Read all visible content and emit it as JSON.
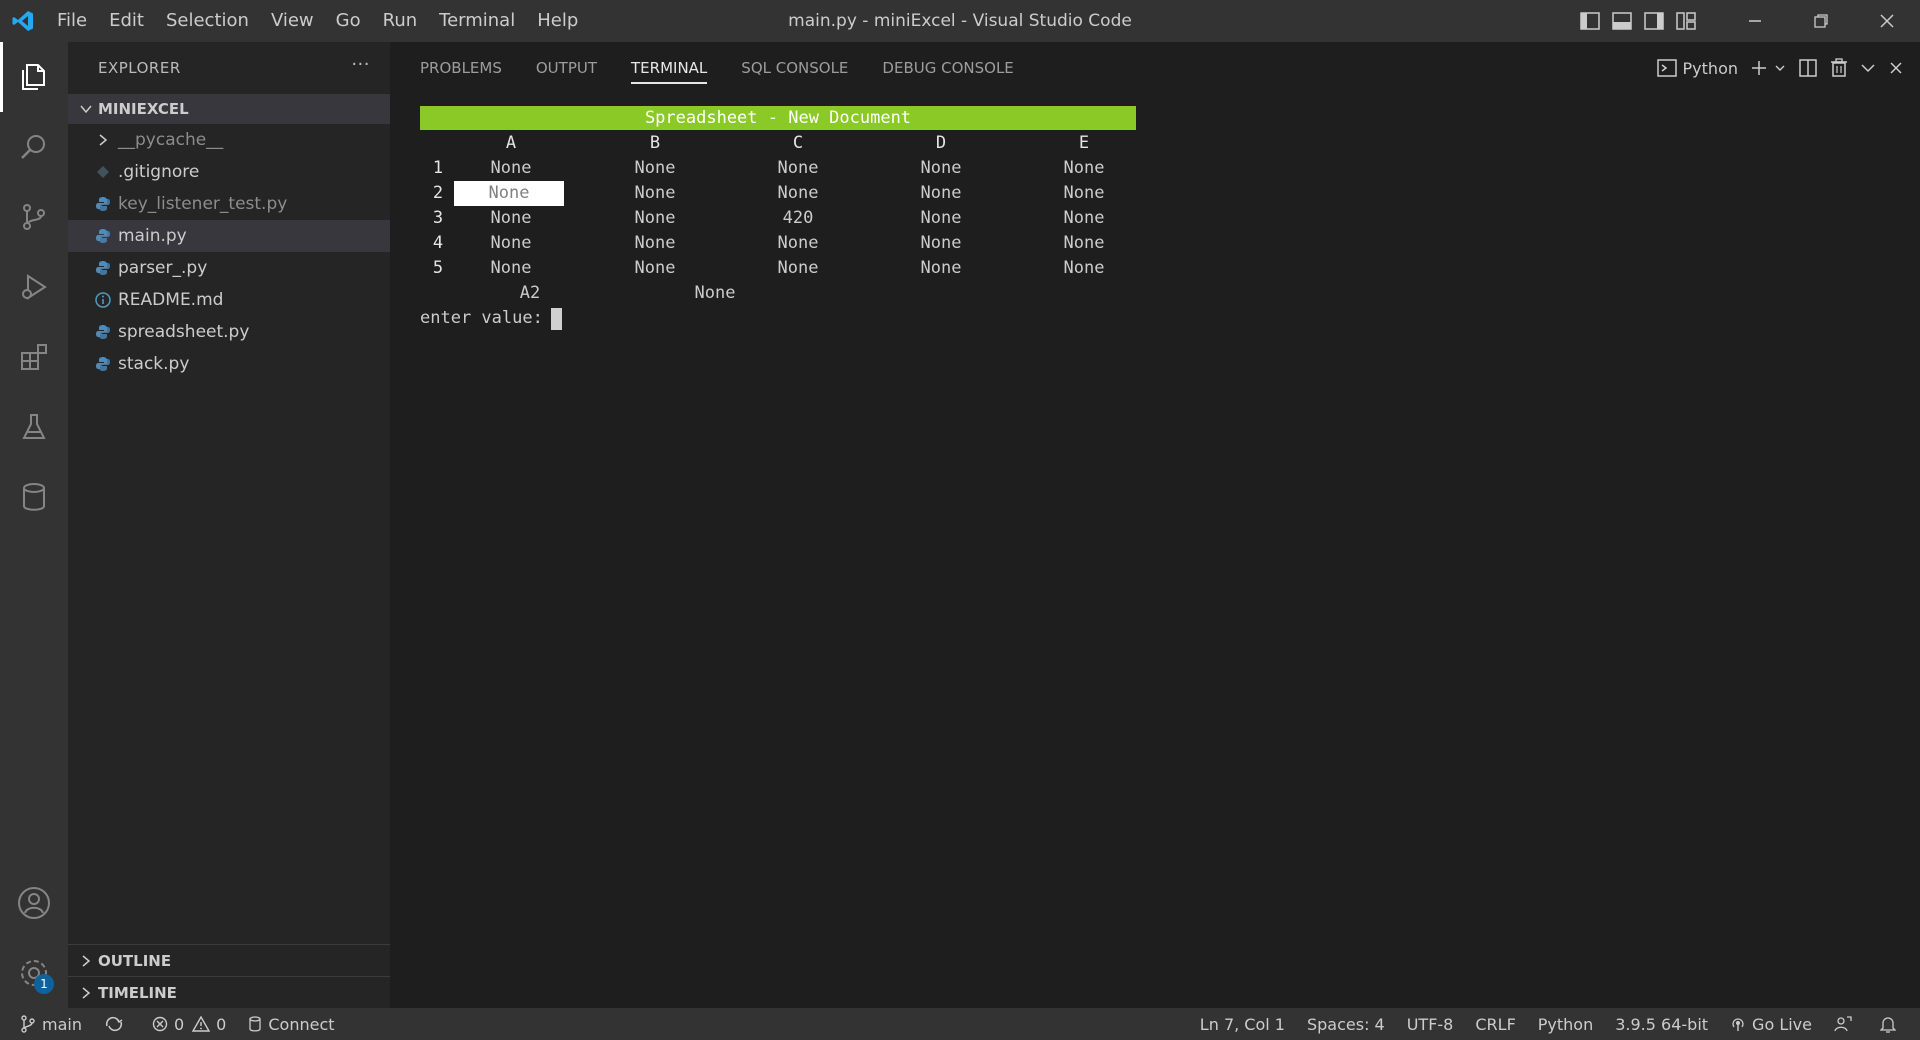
{
  "titlebar": {
    "menu": [
      "File",
      "Edit",
      "Selection",
      "View",
      "Go",
      "Run",
      "Terminal",
      "Help"
    ],
    "window_title": "main.py - miniExcel - Visual Studio Code"
  },
  "sidebar": {
    "title": "EXPLORER",
    "more": "···",
    "folder": "MINIEXCEL",
    "items": [
      {
        "label": "__pycache__",
        "icon": "chevron-right-icon"
      },
      {
        "label": ".gitignore",
        "icon": "diamond-icon"
      },
      {
        "label": "key_listener_test.py",
        "icon": "python-icon"
      },
      {
        "label": "main.py",
        "icon": "python-icon"
      },
      {
        "label": "parser_.py",
        "icon": "python-icon"
      },
      {
        "label": "README.md",
        "icon": "info-icon"
      },
      {
        "label": "spreadsheet.py",
        "icon": "python-icon"
      },
      {
        "label": "stack.py",
        "icon": "python-icon"
      }
    ],
    "outline": "OUTLINE",
    "timeline": "TIMELINE",
    "settings_badge": "1"
  },
  "panel": {
    "tabs": [
      "PROBLEMS",
      "OUTPUT",
      "TERMINAL",
      "SQL CONSOLE",
      "DEBUG CONSOLE"
    ],
    "active_tab": "TERMINAL",
    "terminal_profile": "Python"
  },
  "terminal": {
    "title": "Spreadsheet - New Document",
    "columns": [
      "A",
      "B",
      "C",
      "D",
      "E"
    ],
    "rows": [
      {
        "num": "1",
        "cells": [
          "None",
          "None",
          "None",
          "None",
          "None"
        ]
      },
      {
        "num": "2",
        "cells": [
          "None",
          "None",
          "None",
          "None",
          "None"
        ]
      },
      {
        "num": "3",
        "cells": [
          "None",
          "None",
          "420",
          "None",
          "None"
        ]
      },
      {
        "num": "4",
        "cells": [
          "None",
          "None",
          "None",
          "None",
          "None"
        ]
      },
      {
        "num": "5",
        "cells": [
          "None",
          "None",
          "None",
          "None",
          "None"
        ]
      }
    ],
    "selected_cell_address": "A2",
    "selected_cell_value": "None",
    "prompt": "enter value:"
  },
  "statusbar": {
    "branch": "main",
    "errors": "0",
    "warnings": "0",
    "connect": "Connect",
    "position": "Ln 7, Col 1",
    "spaces": "Spaces: 4",
    "encoding": "UTF-8",
    "eol": "CRLF",
    "language": "Python",
    "interpreter": "3.9.5 64-bit",
    "go_live": "Go Live"
  },
  "colors": {
    "accent": "#8ac926",
    "bar_bg": "#333333",
    "sidebar_bg": "#252526",
    "editor_bg": "#1e1e1e"
  }
}
